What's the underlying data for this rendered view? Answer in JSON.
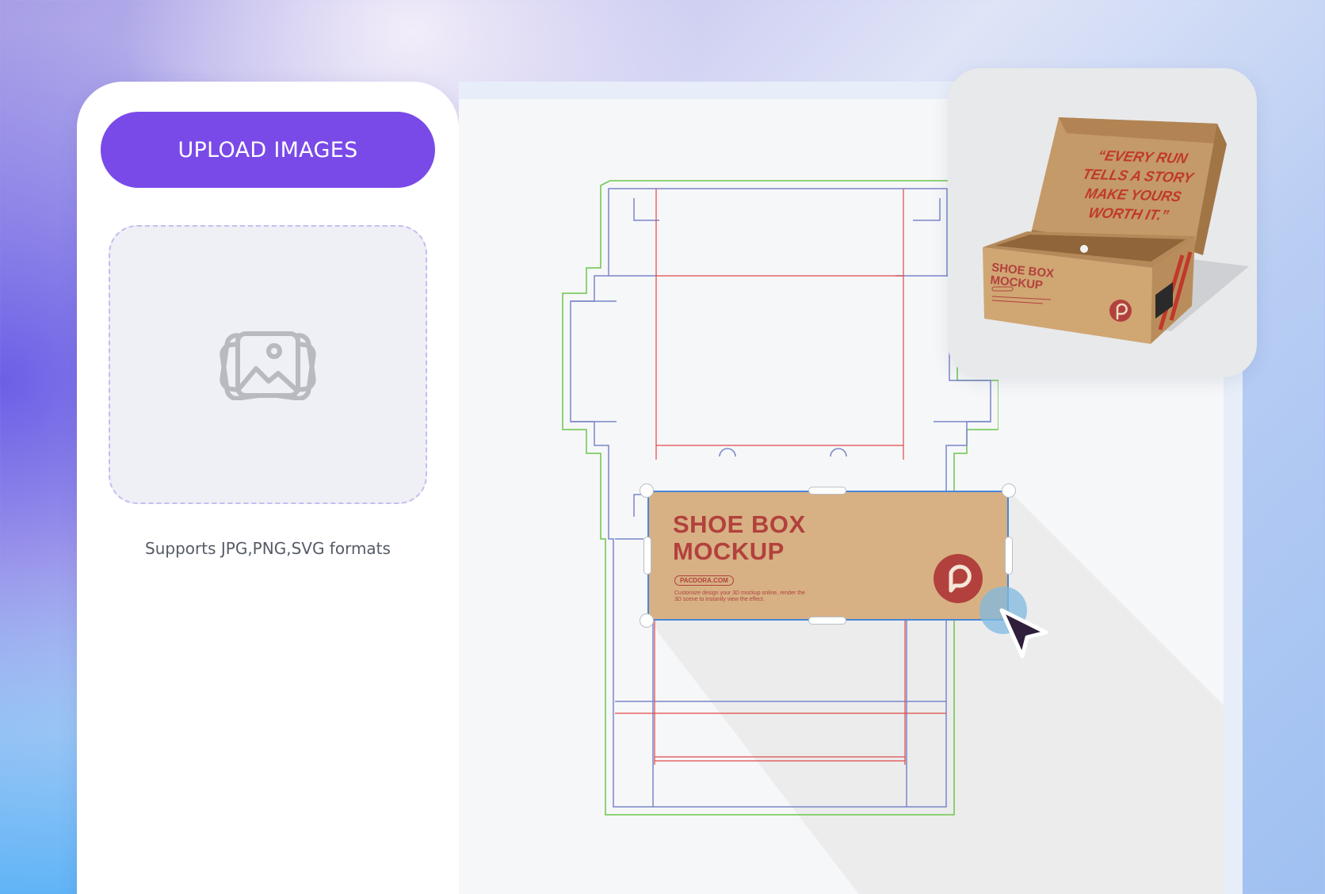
{
  "left_panel": {
    "upload_button_label": "UPLOAD IMAGES",
    "dropzone_icon": "images-icon",
    "formats_note": "Supports JPG,PNG,SVG formats"
  },
  "label": {
    "title_line1": "SHOE BOX",
    "title_line2": "MOCKUP",
    "url": "PACDORA.COM",
    "tagline": "Customize design your 3D mockup online, render the 3D scene to instantly view the effect.",
    "logo_icon": "pacdora-logo-icon"
  },
  "preview": {
    "lid_quote": "“EVERY RUN TELLS A STORY MAKE YOURS WORTH IT.”",
    "side_title_line1": "SHOE BOX",
    "side_title_line2": "MOCKUP"
  },
  "colors": {
    "accent": "#7a4ae8",
    "kraft": "#d7b184",
    "brand_red": "#b2413d",
    "cut_line": "#7a86c9",
    "fold_line": "#e04a4a",
    "bleed_line": "#6cc54a",
    "selection": "#4a86d9"
  }
}
